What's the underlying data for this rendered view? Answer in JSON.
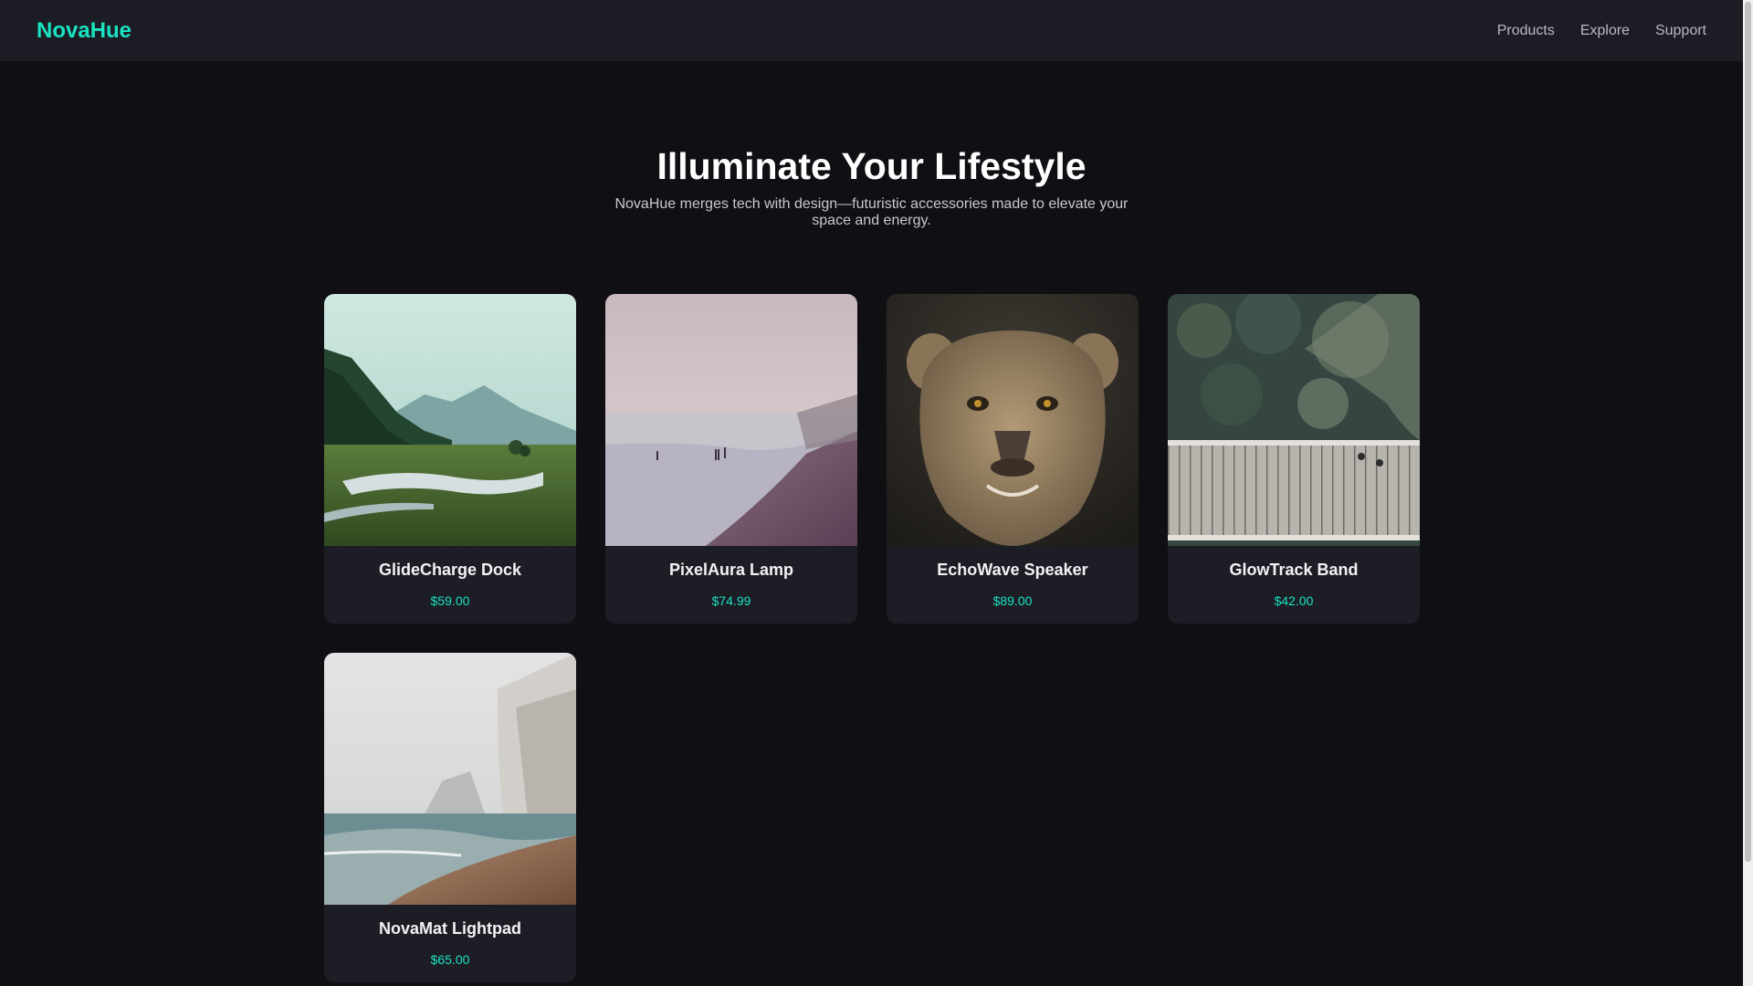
{
  "nav": {
    "brand": "NovaHue",
    "links": [
      "Products",
      "Explore",
      "Support"
    ]
  },
  "hero": {
    "title": "Illuminate Your Lifestyle",
    "subtitle": "NovaHue merges tech with design—futuristic accessories made to elevate your space and energy."
  },
  "products": [
    {
      "name": "GlideCharge Dock",
      "price": "$59.00"
    },
    {
      "name": "PixelAura Lamp",
      "price": "$74.99"
    },
    {
      "name": "EchoWave Speaker",
      "price": "$89.00"
    },
    {
      "name": "GlowTrack Band",
      "price": "$42.00"
    },
    {
      "name": "NovaMat Lightpad",
      "price": "$65.00"
    }
  ],
  "colors": {
    "background": "#0f0f14",
    "navbar": "#1c1c24",
    "card": "#1d1d26",
    "accent": "#19e3c1",
    "text": "#ffffff",
    "muted": "#b9b9c2"
  }
}
